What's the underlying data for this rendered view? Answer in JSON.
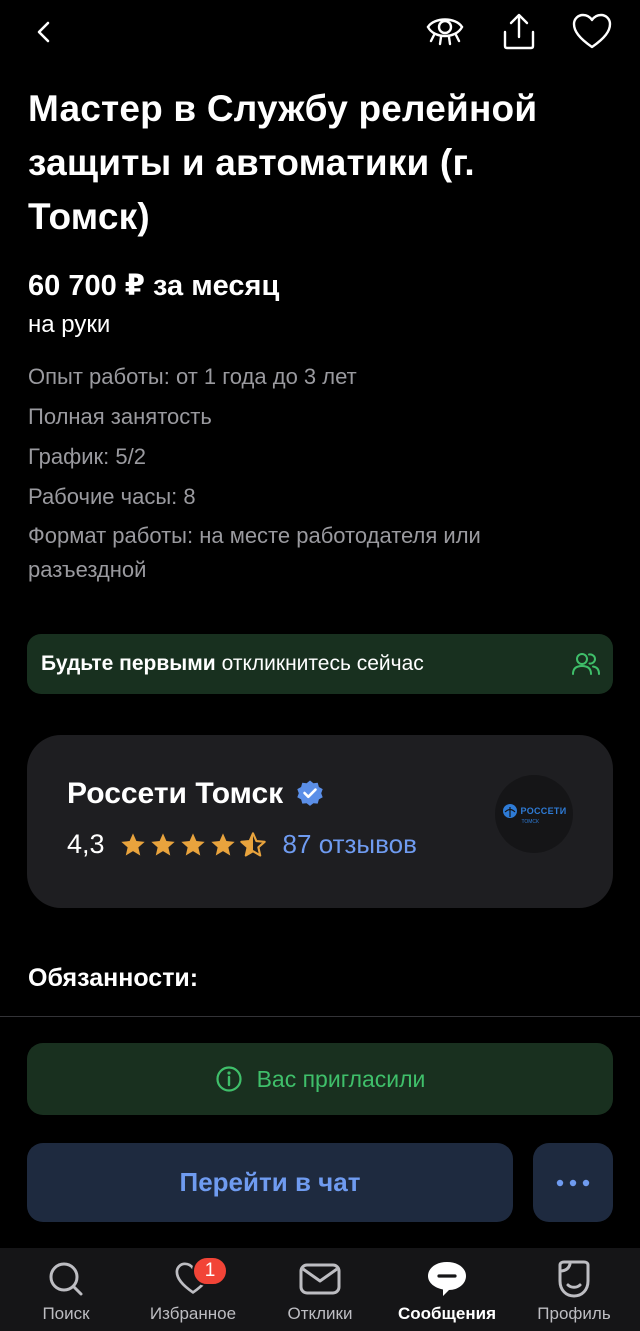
{
  "vacancy": {
    "title": "Мастер в Службу релейной защиты и автоматики (г. Томск)",
    "salary": "60 700 ₽ за месяц",
    "salary_note": "на руки",
    "details": [
      "Опыт работы: от 1 года до 3 лет",
      "Полная занятость",
      "График: 5/2",
      "Рабочие часы: 8",
      "Формат работы: на месте работодателя или разъездной"
    ]
  },
  "banner": {
    "bold": "Будьте первыми",
    "text": "откликнитесь сейчас"
  },
  "company": {
    "name": "Россети Томск",
    "rating": "4,3",
    "rating_value": 4.3,
    "reviews": "87 отзывов",
    "logo_text": "РОССЕТИ",
    "logo_sub": "ТОМСК"
  },
  "section": {
    "duties_title": "Обязанности:"
  },
  "actions": {
    "invited_label": "Вас пригласили",
    "chat_label": "Перейти в чат"
  },
  "tabbar": {
    "items": [
      {
        "label": "Поиск",
        "icon": "search-icon"
      },
      {
        "label": "Избранное",
        "icon": "heart-icon",
        "badge": "1"
      },
      {
        "label": "Отклики",
        "icon": "envelope-icon"
      },
      {
        "label": "Сообщения",
        "icon": "chat-bubble-icon",
        "active": true
      },
      {
        "label": "Профиль",
        "icon": "profile-icon"
      }
    ]
  },
  "colors": {
    "background": "#000000",
    "card": "#1e1e21",
    "green_banner": "#18301f",
    "green_text": "#3fbf6a",
    "accent_blue": "#6f9bf0",
    "button_bg": "#1e2a3f",
    "star": "#e8a33d",
    "badge": "#f24437"
  }
}
